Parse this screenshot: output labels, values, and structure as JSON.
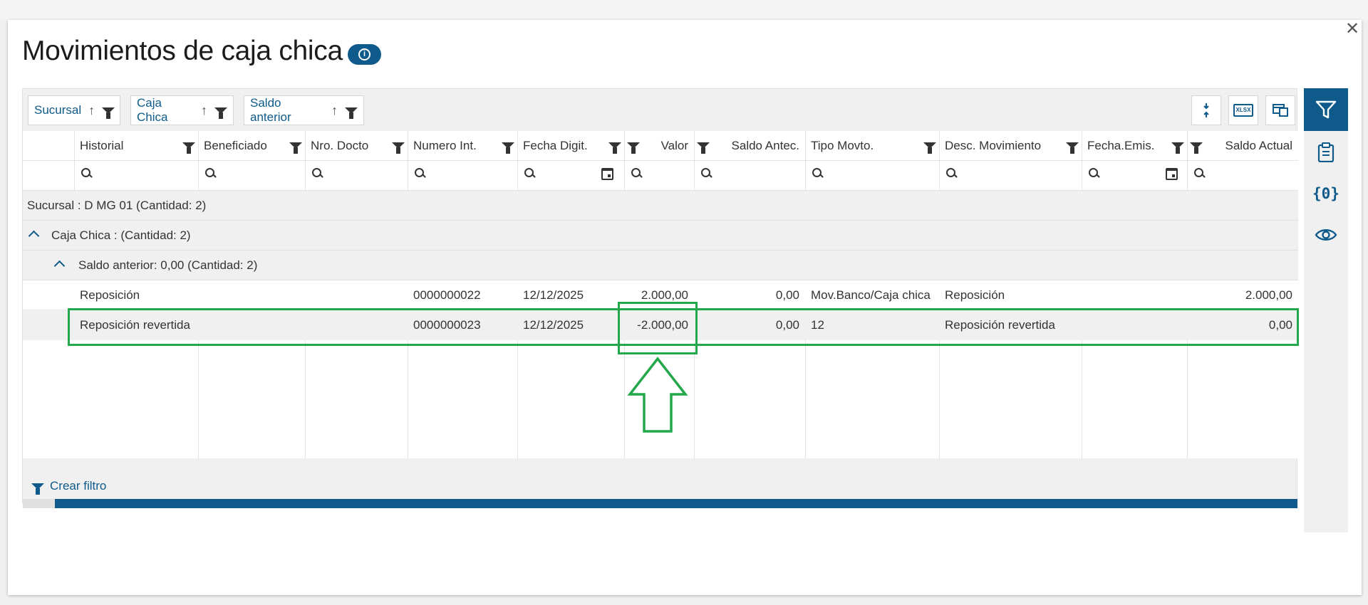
{
  "window": {
    "close_glyph": "✕"
  },
  "page": {
    "title": "Movimientos de caja chica",
    "info_icon": "info-icon"
  },
  "group_bar": [
    {
      "label": "Sucursal"
    },
    {
      "label": "Caja Chica"
    },
    {
      "label": "Saldo anterior"
    }
  ],
  "toolbar_icons": [
    "collapse-rows-icon",
    "export-xlsx-icon",
    "column-chooser-icon"
  ],
  "toolbar_xlsx_text": "XLSX",
  "columns": [
    {
      "label": "Historial"
    },
    {
      "label": "Beneficiado"
    },
    {
      "label": "Nro. Docto"
    },
    {
      "label": "Numero Int."
    },
    {
      "label": "Fecha Digit."
    },
    {
      "label": "Valor"
    },
    {
      "label": "Saldo Antec."
    },
    {
      "label": "Tipo Movto."
    },
    {
      "label": "Desc. Movimiento"
    },
    {
      "label": "Fecha.Emis."
    },
    {
      "label": "Saldo Actual"
    }
  ],
  "groups": {
    "sucursal": "Sucursal : D MG 01 (Cantidad: 2)",
    "caja_chica": "Caja Chica : (Cantidad: 2)",
    "saldo_anterior": "Saldo anterior: 0,00 (Cantidad: 2)"
  },
  "rows": [
    {
      "historial": "Reposición",
      "beneficiado": "",
      "nro_docto": "",
      "numero_int": "0000000022",
      "fecha_digit": "12/12/2025",
      "valor": "2.000,00",
      "saldo_antec": "0,00",
      "tipo_movto": "Mov.Banco/Caja chica",
      "desc_movimiento": "Reposición",
      "fecha_emis": "",
      "saldo_actual": "2.000,00"
    },
    {
      "historial": "Reposición revertida",
      "beneficiado": "",
      "nro_docto": "",
      "numero_int": "0000000023",
      "fecha_digit": "12/12/2025",
      "valor": "-2.000,00",
      "saldo_antec": "0,00",
      "tipo_movto": "12",
      "desc_movimiento": "Reposición revertida",
      "fecha_emis": "",
      "saldo_actual": "0,00"
    }
  ],
  "footer": {
    "create_filter": "Crear filtro"
  },
  "side_panel": [
    "filter-icon",
    "clipboard-icon",
    "variables-icon",
    "eye-icon"
  ],
  "side_variables_text": "{0}",
  "colors": {
    "accent": "#0e5a8a",
    "highlight": "#22a84a"
  }
}
